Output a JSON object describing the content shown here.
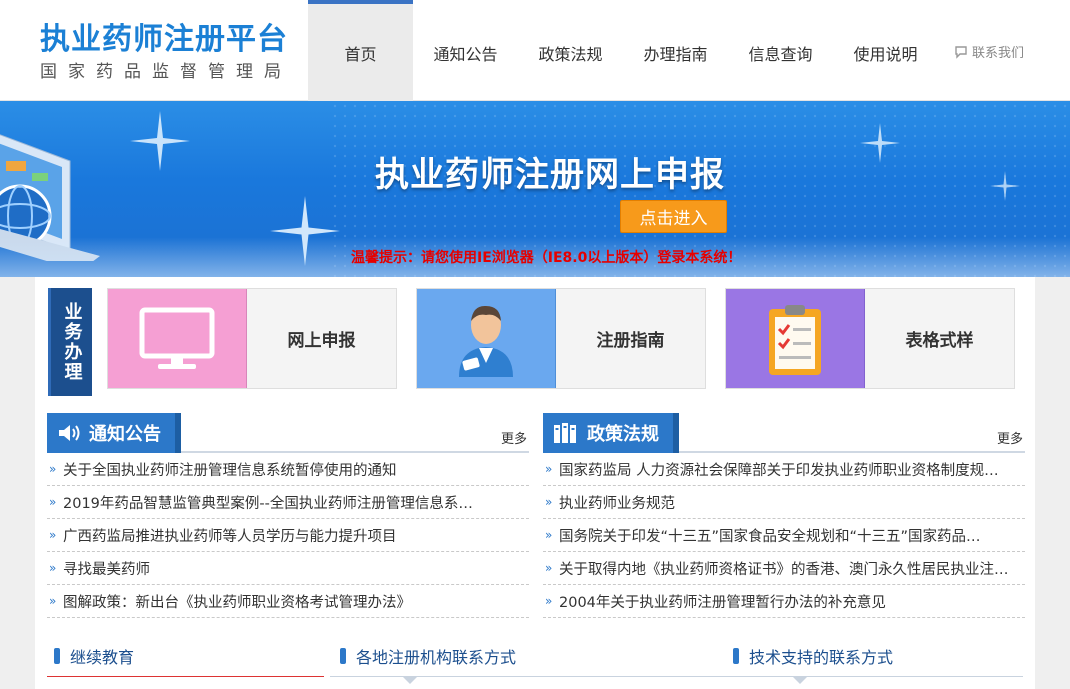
{
  "header": {
    "logo_title": "执业药师注册平台",
    "logo_subtitle": "国家药品监督管理局",
    "nav": [
      "首页",
      "通知公告",
      "政策法规",
      "办理指南",
      "信息查询",
      "使用说明"
    ],
    "active_nav": "首页",
    "contact_label": "联系我们"
  },
  "banner": {
    "title": "执业药师注册网上申报",
    "enter_label": "点击进入",
    "tip": "温馨提示：请您使用IE浏览器（IE8.0以上版本）登录本系统！"
  },
  "business": {
    "label": "业务办理",
    "cards": [
      {
        "label": "网上申报",
        "icon": "monitor-icon",
        "color": "#f59fd3"
      },
      {
        "label": "注册指南",
        "icon": "user-icon",
        "color": "#6aa8ef"
      },
      {
        "label": "表格式样",
        "icon": "clipboard-icon",
        "color": "#9a76e4"
      }
    ]
  },
  "notices": {
    "title": "通知公告",
    "more": "更多",
    "items": [
      "关于全国执业药师注册管理信息系统暂停使用的通知",
      "2019年药品智慧监管典型案例--全国执业药师注册管理信息系…",
      "广西药监局推进执业药师等人员学历与能力提升项目",
      "寻找最美药师",
      "图解政策：新出台《执业药师职业资格考试管理办法》"
    ]
  },
  "policies": {
    "title": "政策法规",
    "more": "更多",
    "items": [
      "国家药监局 人力资源社会保障部关于印发执业药师职业资格制度规…",
      "执业药师业务规范",
      "国务院关于印发“十三五”国家食品安全规划和“十三五”国家药品…",
      "关于取得内地《执业药师资格证书》的香港、澳门永久性居民执业注…",
      "2004年关于执业药师注册管理暂行办法的补充意见"
    ]
  },
  "bottom_sections": [
    "继续教育",
    "各地注册机构联系方式",
    "技术支持的联系方式"
  ],
  "colors": {
    "brand": "#1b80d5",
    "accent": "#2c78c9",
    "button": "#f79a1b",
    "tip": "#e60000"
  }
}
